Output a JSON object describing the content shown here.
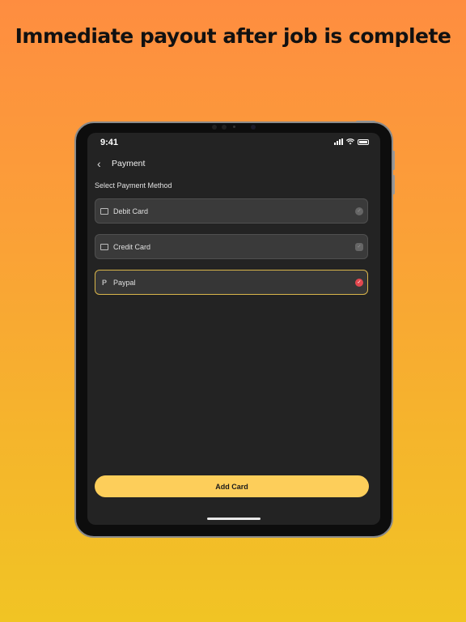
{
  "headline": "Immediate payout after job is complete",
  "status_bar": {
    "time": "9:41"
  },
  "header": {
    "back_icon": "‹",
    "title": "Payment"
  },
  "section_label": "Select Payment Method",
  "payment_methods": [
    {
      "label": "Debit Card",
      "icon": "card-icon",
      "selected": false
    },
    {
      "label": "Credit Card",
      "icon": "card-icon",
      "selected": false
    },
    {
      "label": "Paypal",
      "icon": "paypal-icon",
      "selected": true
    }
  ],
  "add_card_label": "Add Card",
  "colors": {
    "accent": "#fdce5a",
    "selected_border": "#d9b54a",
    "active_radio": "#e2474e",
    "screen_bg": "#232323"
  }
}
